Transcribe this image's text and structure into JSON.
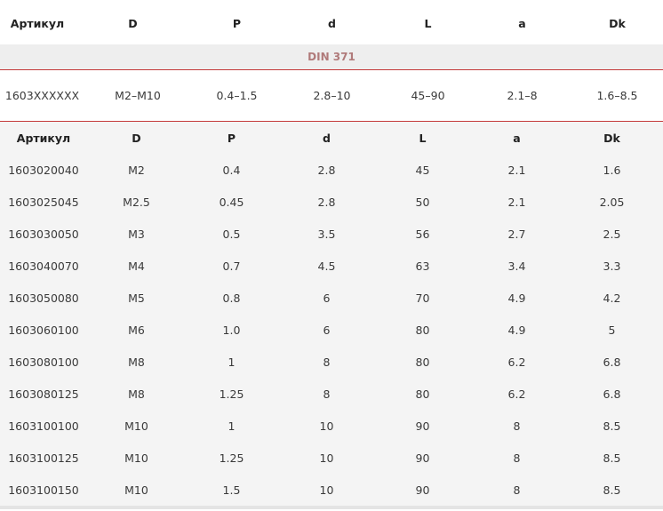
{
  "top_header": [
    "Артикул",
    "D",
    "P",
    "d",
    "L",
    "a",
    "Dk"
  ],
  "group_label": "DIN 371",
  "summary_row": [
    "1603XXXXXX",
    "M2–M10",
    "0.4–1.5",
    "2.8–10",
    "45–90",
    "2.1–8",
    "1.6–8.5"
  ],
  "table": {
    "columns": [
      "Артикул",
      "D",
      "P",
      "d",
      "L",
      "a",
      "Dk"
    ],
    "rows": [
      [
        "1603020040",
        "M2",
        "0.4",
        "2.8",
        "45",
        "2.1",
        "1.6"
      ],
      [
        "1603025045",
        "M2.5",
        "0.45",
        "2.8",
        "50",
        "2.1",
        "2.05"
      ],
      [
        "1603030050",
        "M3",
        "0.5",
        "3.5",
        "56",
        "2.7",
        "2.5"
      ],
      [
        "1603040070",
        "M4",
        "0.7",
        "4.5",
        "63",
        "3.4",
        "3.3"
      ],
      [
        "1603050080",
        "M5",
        "0.8",
        "6",
        "70",
        "4.9",
        "4.2"
      ],
      [
        "1603060100",
        "M6",
        "1.0",
        "6",
        "80",
        "4.9",
        "5"
      ],
      [
        "1603080100",
        "M8",
        "1",
        "8",
        "80",
        "6.2",
        "6.8"
      ],
      [
        "1603080125",
        "M8",
        "1.25",
        "8",
        "80",
        "6.2",
        "6.8"
      ],
      [
        "1603100100",
        "M10",
        "1",
        "10",
        "90",
        "8",
        "8.5"
      ],
      [
        "1603100125",
        "M10",
        "1.25",
        "10",
        "90",
        "8",
        "8.5"
      ],
      [
        "1603100150",
        "M10",
        "1.5",
        "10",
        "90",
        "8",
        "8.5"
      ]
    ]
  }
}
